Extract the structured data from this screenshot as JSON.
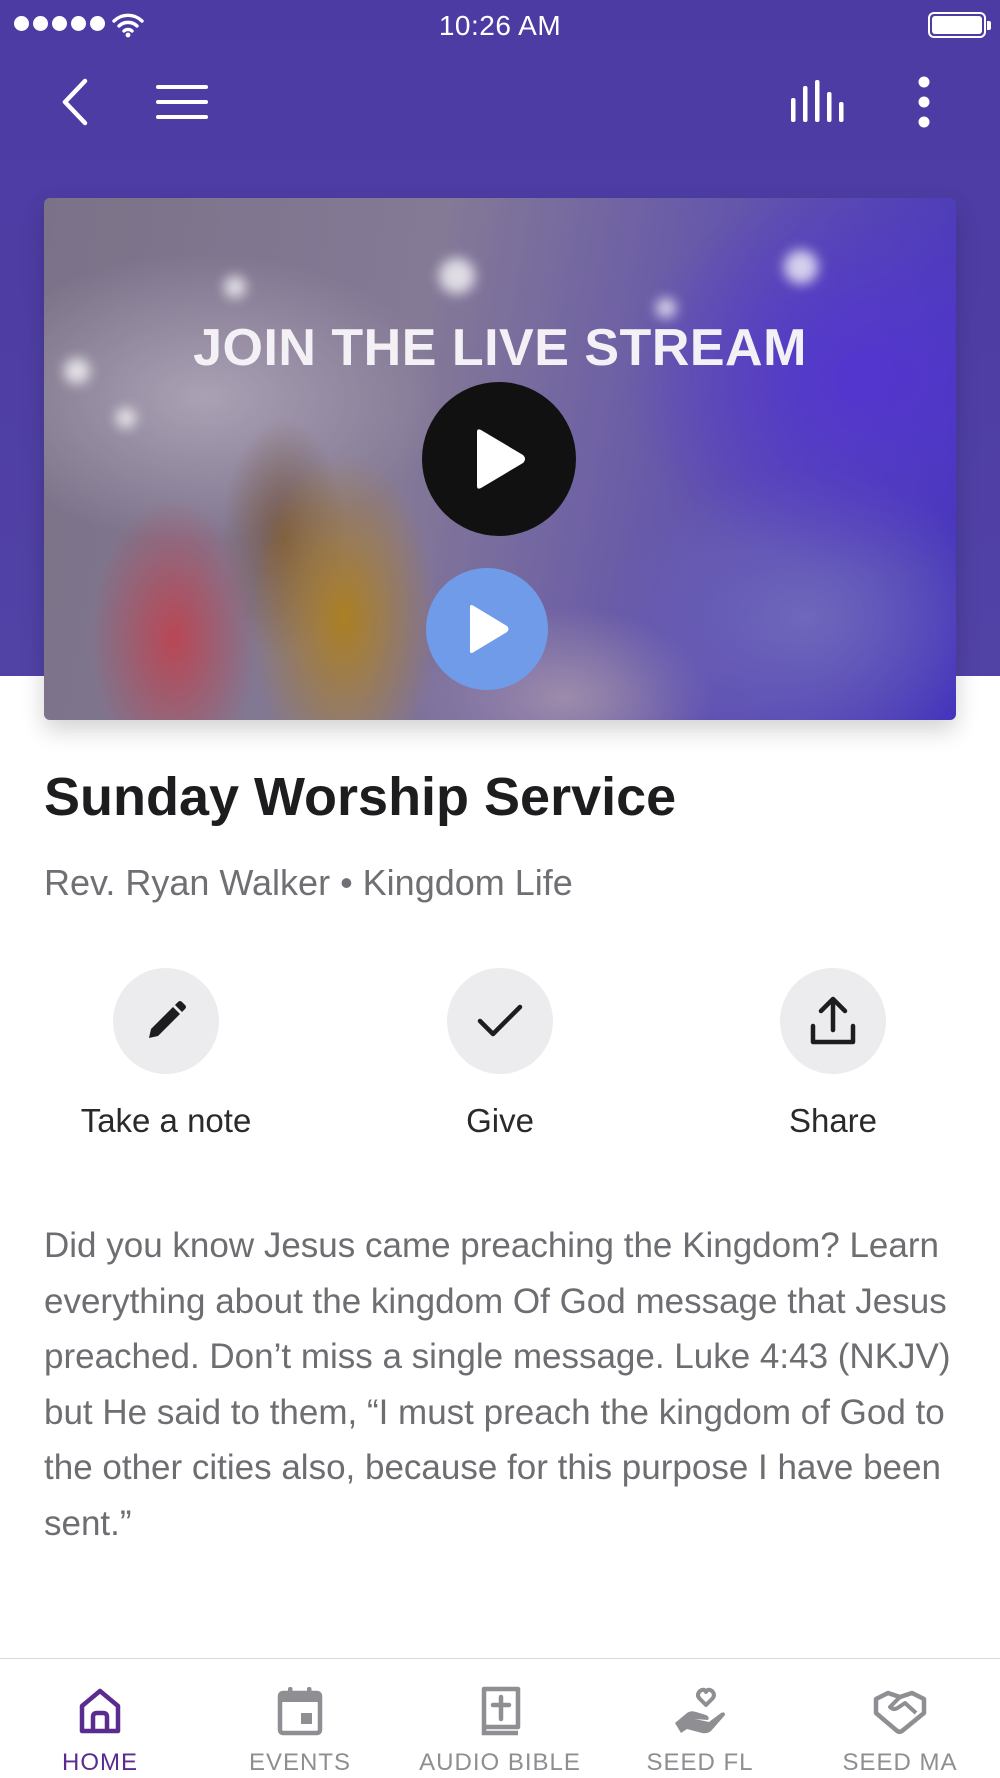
{
  "status_bar": {
    "time": "10:26 AM"
  },
  "nav": {
    "back_icon": "chevron-left-icon",
    "menu_icon": "hamburger-icon",
    "audio_icon": "audio-bars-icon",
    "more_icon": "more-vertical-icon"
  },
  "video": {
    "overlay_text": "JOIN THE LIVE STREAM"
  },
  "media": {
    "title": "Sunday Worship Service",
    "subtitle": "Rev. Ryan Walker • Kingdom Life"
  },
  "actions": [
    {
      "label": "Take a note",
      "icon": "pencil-icon"
    },
    {
      "label": "Give",
      "icon": "checkmark-icon"
    },
    {
      "label": "Share",
      "icon": "share-icon"
    }
  ],
  "description": "Did you know Jesus came preaching the Kingdom? Learn everything about the kingdom Of God message that Jesus preached. Don’t miss a single message. Luke 4:43 (NKJV) but He said to them, “I must preach the kingdom of God to the other cities also, because for this purpose I have been sent.”",
  "tabs": [
    {
      "label": "HOME",
      "icon": "home-icon",
      "active": true
    },
    {
      "label": "EVENTS",
      "icon": "calendar-icon",
      "active": false
    },
    {
      "label": "AUDIO BIBLE",
      "icon": "bible-icon",
      "active": false
    },
    {
      "label": "SEED FL",
      "icon": "giving-hand-icon",
      "active": false
    },
    {
      "label": "SEED MA",
      "icon": "handshake-icon",
      "active": false
    }
  ],
  "colors": {
    "header": "#4c3ba3",
    "active_tab": "#5b2c8f",
    "inactive_tab": "#8e8e93"
  }
}
